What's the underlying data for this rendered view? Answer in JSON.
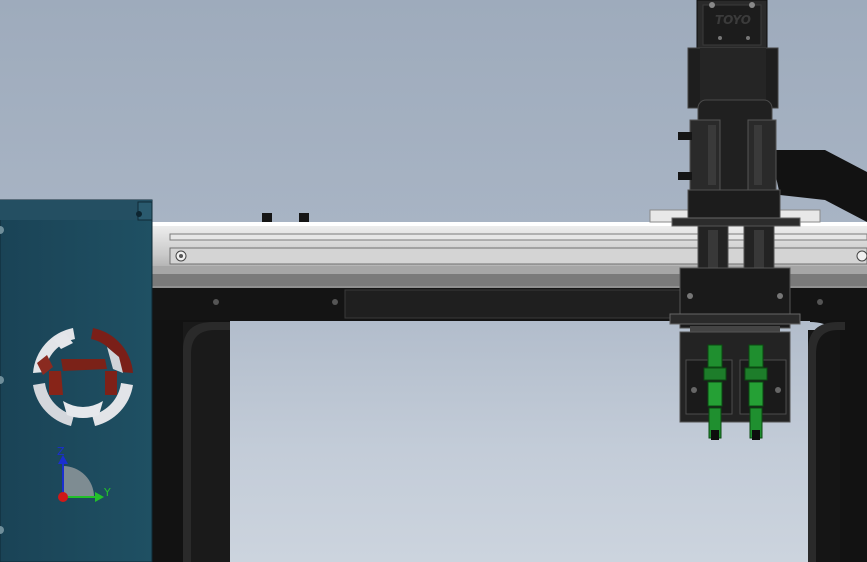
{
  "app": {
    "kind": "3D CAD model viewport"
  },
  "viewport": {
    "background_top": "#9eabbc",
    "background_bottom": "#ccd4de"
  },
  "model": {
    "carriage_logo_text": "TOYO",
    "fitting_color": "#1f8f2f",
    "frame_color": "#111111",
    "rail_color": "#c8c8c8",
    "panel_color": "#1c4a5c"
  },
  "triad": {
    "z_label": "Z",
    "y_label": "Y",
    "z_color": "#1a2fd0",
    "y_color": "#22c02a",
    "x_color": "#d01818"
  },
  "icons": {
    "view_cube": "orientation-wheel-icon"
  }
}
